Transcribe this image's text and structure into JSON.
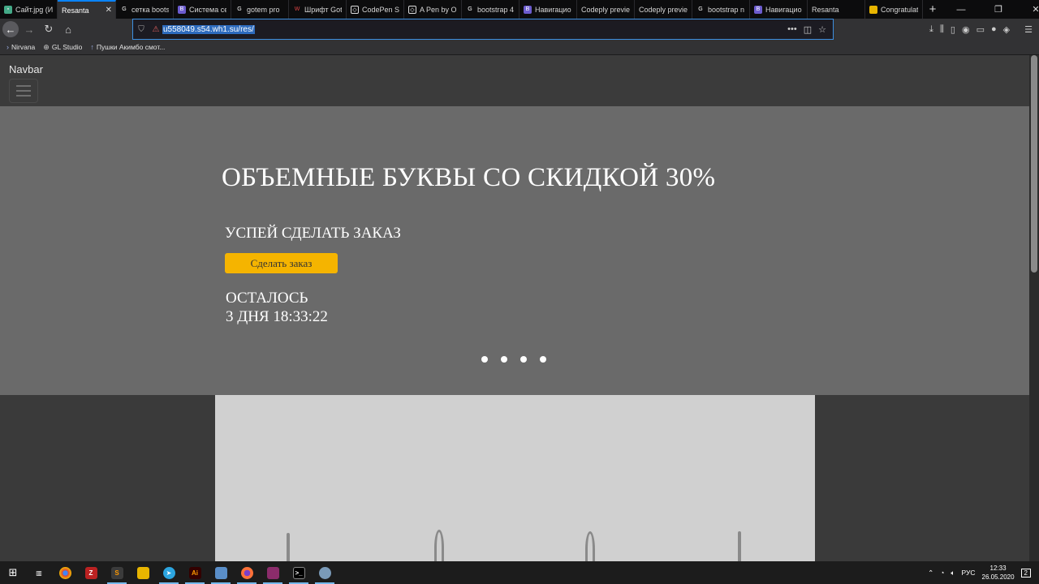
{
  "browser": {
    "tabs": [
      {
        "label": "Сайт.jpg (Изоб",
        "icon": "image-icon"
      },
      {
        "label": "Resanta",
        "icon": "",
        "active": true
      },
      {
        "label": "сетка bootst",
        "icon": "google-icon"
      },
      {
        "label": "Система се",
        "icon": "b-icon"
      },
      {
        "label": "gotem pro",
        "icon": "google-icon"
      },
      {
        "label": "Шрифт Got",
        "icon": "wf-icon"
      },
      {
        "label": "CodePen Se",
        "icon": "codepen-icon"
      },
      {
        "label": "A Pen by Oi",
        "icon": "codepen-icon"
      },
      {
        "label": "bootstrap 4",
        "icon": "google-icon"
      },
      {
        "label": "Навигацио",
        "icon": "b-icon"
      },
      {
        "label": "Codeply preview",
        "icon": ""
      },
      {
        "label": "Codeply preview",
        "icon": ""
      },
      {
        "label": "bootstrap n",
        "icon": "google-icon"
      },
      {
        "label": "Навигацио",
        "icon": "b-icon"
      },
      {
        "label": "Resanta",
        "icon": ""
      },
      {
        "label": "Congratulat",
        "icon": "folder-icon"
      }
    ],
    "url": "u558049.s54.wh1.su/res/",
    "bookmarks": [
      {
        "label": "Nirvana"
      },
      {
        "label": "GL Studio"
      },
      {
        "label": "Пушки Акимбо смот..."
      }
    ]
  },
  "page": {
    "brand": "Navbar",
    "hero": {
      "title": "ОБЪЕМНЫЕ БУКВЫ СО СКИДКОЙ 30%",
      "subtitle": "УСПЕЙ СДЕЛАТЬ ЗАКАЗ",
      "cta_label": "Сделать заказ",
      "countdown_label": "ОСТАЛОСЬ",
      "countdown_value": "3 ДНЯ 18:33:22",
      "carousel_indicators": 4
    }
  },
  "taskbar": {
    "apps": [
      "start-icon",
      "task-view-icon",
      "chrome-icon",
      "filezilla-icon",
      "sublime-icon",
      "explorer-icon",
      "telegram-icon",
      "illustrator-icon",
      "monitor-icon",
      "firefox-icon",
      "winrar-icon",
      "terminal-icon",
      "tool-icon"
    ],
    "language": "РУС",
    "time": "12:33",
    "date": "26.05.2020",
    "notifications": "2"
  },
  "colors": {
    "hero_bg": "#6a6a6a",
    "cta_bg": "#f5b400",
    "url_highlight": "#2d6bbd",
    "accent": "#0a84ff"
  }
}
